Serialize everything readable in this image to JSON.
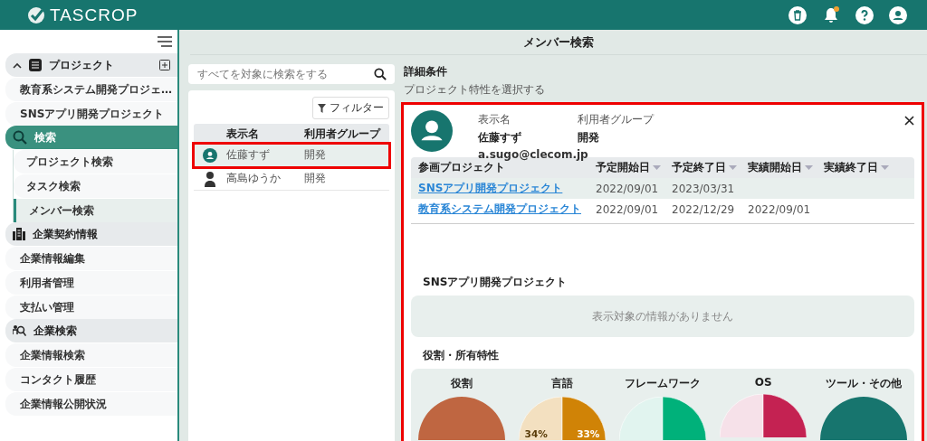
{
  "header": {
    "logo": "TASCROP",
    "notification_badge": true
  },
  "sidebar": {
    "groups": [
      {
        "label": "プロジェクト",
        "expanded": true,
        "selected": false,
        "add_button": true,
        "children": [
          {
            "label": "教育系システム開発プロジェ…",
            "selected": false
          },
          {
            "label": "SNSアプリ開発プロジェクト",
            "selected": false
          }
        ]
      },
      {
        "label": "検索",
        "selected": true,
        "children": [
          {
            "label": "プロジェクト検索",
            "selected": false
          },
          {
            "label": "タスク検索",
            "selected": false
          },
          {
            "label": "メンバー検索",
            "selected": true
          }
        ]
      },
      {
        "label": "企業契約情報",
        "selected": false,
        "children": [
          {
            "label": "企業情報編集",
            "selected": false
          },
          {
            "label": "利用者管理",
            "selected": false
          },
          {
            "label": "支払い管理",
            "selected": false
          }
        ]
      },
      {
        "label": "企業検索",
        "selected": false,
        "children": [
          {
            "label": "企業情報検索",
            "selected": false
          },
          {
            "label": "コンタクト履歴",
            "selected": false
          },
          {
            "label": "企業情報公開状況",
            "selected": false
          }
        ]
      }
    ]
  },
  "page_title": "メンバー検索",
  "search": {
    "placeholder": "すべてを対象に検索をする"
  },
  "filter_button": "フィルター",
  "members": {
    "columns": [
      "表示名",
      "利用者グループ"
    ],
    "rows": [
      {
        "name": "佐藤すず",
        "group": "開発",
        "kind": "default",
        "selected": true,
        "highlighted": true
      },
      {
        "name": "高島ゆうか",
        "group": "開発",
        "kind": "person",
        "selected": false,
        "highlighted": false
      }
    ]
  },
  "conditions": {
    "heading": "詳細条件",
    "hint": "プロジェクト特性を選択する"
  },
  "detail": {
    "highlighted": true,
    "name_label": "表示名",
    "group_label": "利用者グループ",
    "name": "佐藤すず",
    "group": "開発",
    "email": "a.sugo@clecom.jp",
    "projects": {
      "columns": [
        "参画プロジェクト",
        "予定開始日",
        "予定終了日",
        "実績開始日",
        "実績終了日"
      ],
      "rows": [
        {
          "cells": [
            "SNSアプリ開発プロジェクト",
            "2022/09/01",
            "2023/03/31"
          ],
          "selected": true
        },
        {
          "cells": [
            "教育系システム開発プロジェクト",
            "2022/09/01",
            "2022/12/29",
            "2022/09/01"
          ],
          "selected": false
        }
      ]
    },
    "section_title": "SNSアプリ開発プロジェクト",
    "empty_message": "表示対象の情報がありません",
    "traits_title": "役割・所有特性",
    "charts": [
      {
        "title": "役割",
        "slices": [
          {
            "color": "#bf6641"
          }
        ]
      },
      {
        "title": "言語",
        "slices": [
          {
            "color": "#f3e0c0",
            "label": "34%"
          },
          {
            "color": "#d08306",
            "label": "33%"
          }
        ]
      },
      {
        "title": "フレームワーク",
        "slices": [
          {
            "color": "#e1f4ef"
          },
          {
            "color": "#00b17a"
          }
        ]
      },
      {
        "title": "OS",
        "slices": [
          {
            "color": "#f6e1e9"
          },
          {
            "color": "#c42252"
          }
        ]
      },
      {
        "title": "ツール・その他",
        "slices": [
          {
            "color": "#17756e"
          }
        ]
      }
    ]
  }
}
